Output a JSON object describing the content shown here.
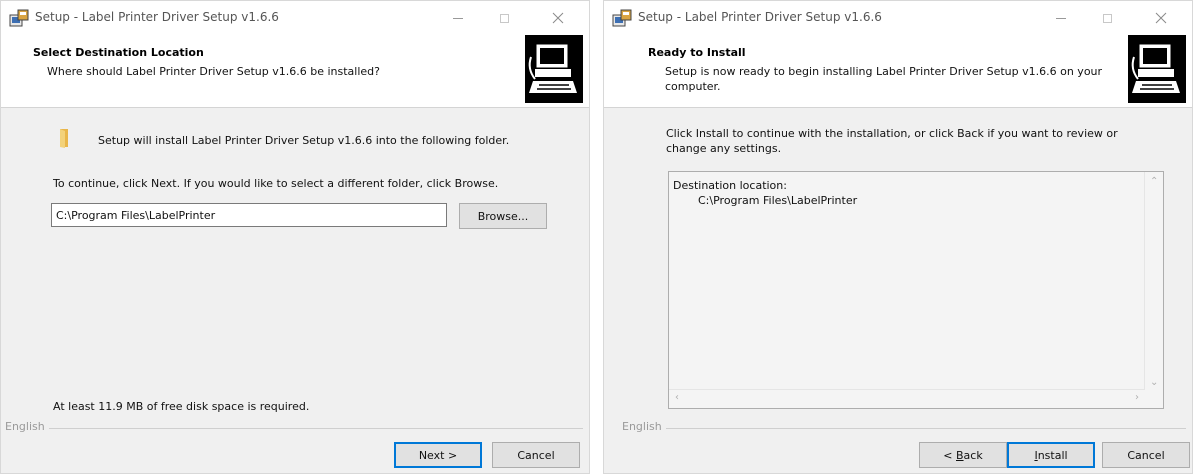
{
  "left_dialog": {
    "window_title": "Setup - Label Printer Driver Setup v1.6.6",
    "header_title": "Select Destination Location",
    "header_desc": "Where should Label Printer Driver Setup v1.6.6 be installed?",
    "install_msg": "Setup will install Label Printer Driver Setup v1.6.6 into the following folder.",
    "continue_msg": "To continue, click Next. If you would like to select a different folder, click Browse.",
    "path_value": "C:\\Program Files\\LabelPrinter",
    "browse_label": "Browse...",
    "disk_space_msg": "At least 11.9 MB of free disk space is required.",
    "language_label": "English",
    "next_label": "Next >",
    "cancel_label": "Cancel"
  },
  "right_dialog": {
    "window_title": "Setup - Label Printer Driver Setup v1.6.6",
    "header_title": "Ready to Install",
    "header_desc": "Setup is now ready to begin installing Label Printer Driver Setup v1.6.6 on your computer.",
    "instructions": "Click Install to continue with the installation, or click Back if you want to review or change any settings.",
    "memo_heading": "Destination location:",
    "memo_value": "C:\\Program Files\\LabelPrinter",
    "language_label": "English",
    "back_prefix": "< ",
    "back_accel": "B",
    "back_rest": "ack",
    "install_accel": "I",
    "install_rest": "nstall",
    "cancel_label": "Cancel"
  },
  "icons": {
    "app": "setup-installer-icon",
    "folder": "folder-icon",
    "wizard": "computer-install-icon",
    "minimize": "minimize-icon",
    "maximize": "maximize-icon",
    "close": "close-icon"
  },
  "colors": {
    "default_button_border": "#0078d7",
    "dialog_bg": "#f0f0f0",
    "header_bg": "#ffffff"
  }
}
